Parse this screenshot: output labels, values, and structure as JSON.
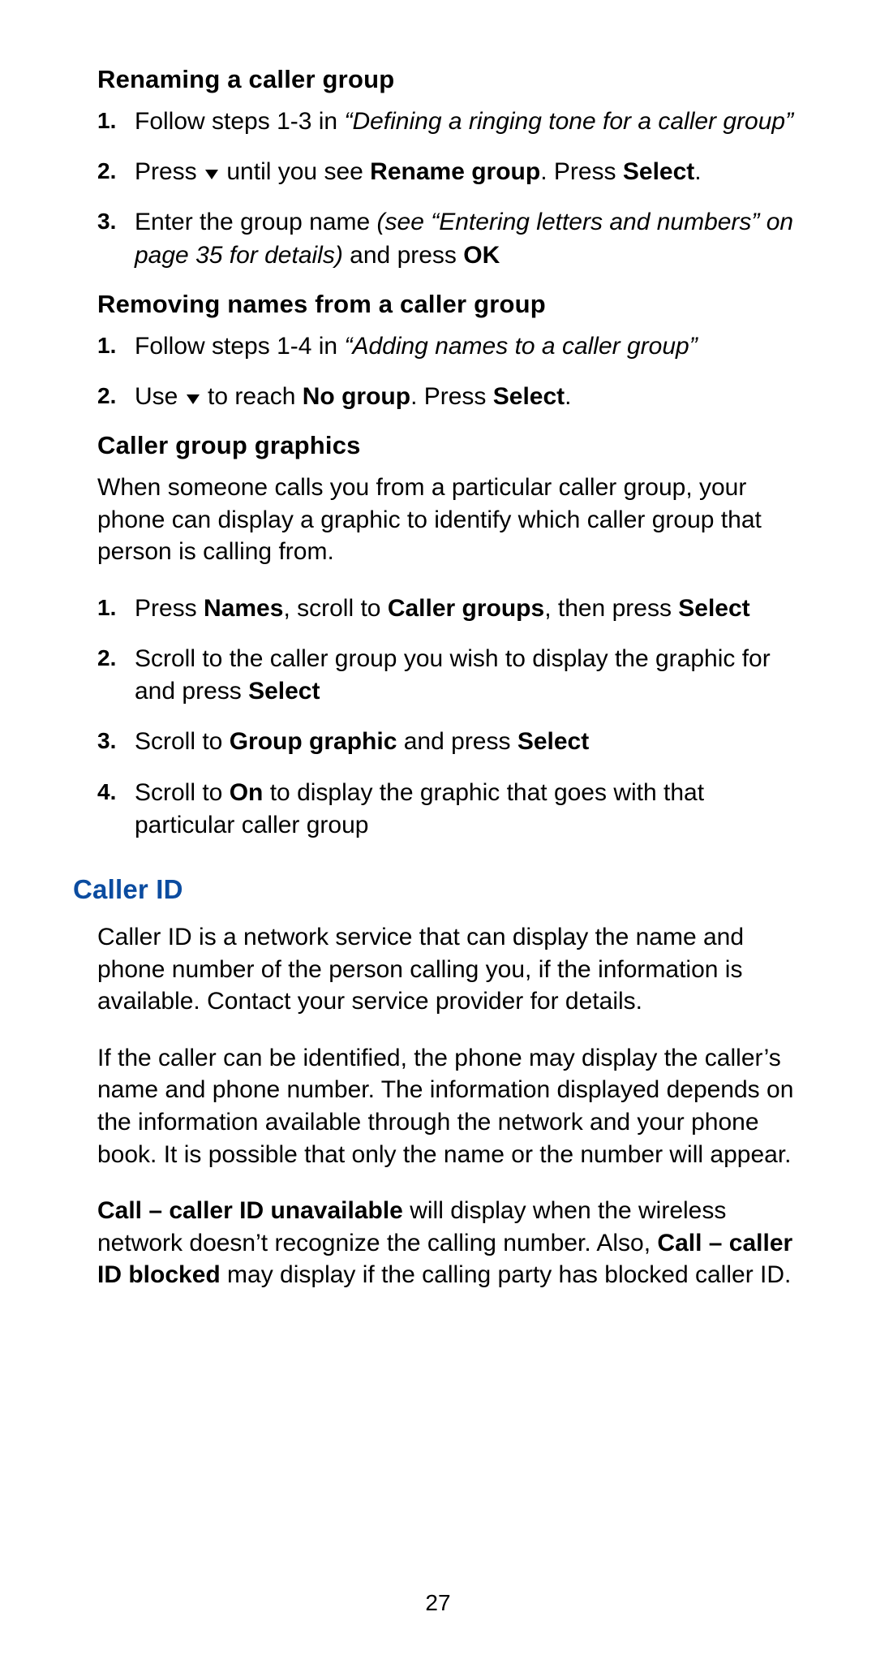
{
  "headings": {
    "rename": "Renaming a caller group",
    "remove": "Removing names from a caller group",
    "graphics": "Caller group graphics",
    "callerid": "Caller ID"
  },
  "rename_steps": {
    "n1": "1.",
    "t1a": "Follow steps 1-3 in ",
    "t1b": "“Defining a ringing tone for a caller group”",
    "n2": "2.",
    "t2a": "Press ",
    "t2b": " until you see ",
    "t2c": "Rename group",
    "t2d": ". Press ",
    "t2e": "Select",
    "t2f": ".",
    "n3": "3.",
    "t3a": "Enter the group name ",
    "t3b": "(see “Entering letters and numbers” on page 35 for details)",
    "t3c": " and press ",
    "t3d": "OK"
  },
  "remove_steps": {
    "n1": "1.",
    "t1a": "Follow steps 1-4 in ",
    "t1b": "“Adding names to a caller group”",
    "n2": "2.",
    "t2a": "Use ",
    "t2b": " to reach ",
    "t2c": "No group",
    "t2d": ". Press ",
    "t2e": "Select",
    "t2f": "."
  },
  "graphics_intro": "When someone calls you from a particular caller group, your phone can display a graphic to identify which caller group that person is calling from.",
  "graphics_steps": {
    "n1": "1.",
    "t1a": "Press ",
    "t1b": "Names",
    "t1c": ", scroll to ",
    "t1d": "Caller groups",
    "t1e": ", then press ",
    "t1f": "Select",
    "n2": "2.",
    "t2a": "Scroll to the caller group you wish to display the graphic for and press ",
    "t2b": "Select",
    "n3": "3.",
    "t3a": "Scroll to ",
    "t3b": "Group graphic",
    "t3c": " and press ",
    "t3d": "Select",
    "n4": "4.",
    "t4a": "Scroll to ",
    "t4b": "On",
    "t4c": " to display the graphic that goes with that particular caller group"
  },
  "callerid_p1": "Caller ID is a network service that can display the name and phone number of the person calling you, if the information is available. Contact your service provider for details.",
  "callerid_p2": "If the caller can be identified, the phone may display the caller’s name and phone number. The information displayed depends on the information available through the network and your phone book. It is possible that only the name or the number will appear.",
  "callerid_p3": {
    "a": "Call – caller ID unavailable",
    "b": " will display when the wireless network doesn’t recognize the calling number. Also, ",
    "c": "Call – caller ID blocked",
    "d": " may display if the calling party has blocked caller ID."
  },
  "page_number": "27"
}
